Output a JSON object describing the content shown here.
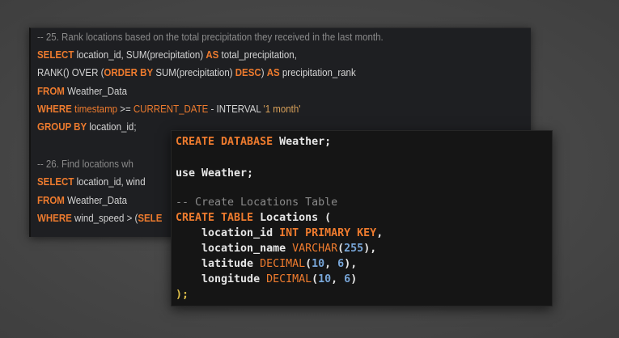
{
  "back_editor": {
    "q25_comment": "-- 25. Rank locations based on the total precipitation they received in the last month.",
    "q25_l1_kw": "SELECT",
    "q25_l1_rest": " location_id, SUM(precipitation) ",
    "q25_l1_as": "AS",
    "q25_l1_tail": " total_precipitation,",
    "q25_l2_a": "RANK() OVER (",
    "q25_l2_kw": "ORDER BY",
    "q25_l2_b": " SUM(precipitation) ",
    "q25_l2_desc": "DESC",
    "q25_l2_c": ") ",
    "q25_l2_as": "AS",
    "q25_l2_tail": " precipitation_rank",
    "q25_l3_kw": "FROM",
    "q25_l3_rest": " Weather_Data",
    "q25_l4_kw": "WHERE",
    "q25_l4_col": " timestamp",
    "q25_l4_op": " >= ",
    "q25_l4_cd": "CURRENT_DATE",
    "q25_l4_mid": " - INTERVAL ",
    "q25_l4_str": "'1 month'",
    "q25_l5_kw": "GROUP BY",
    "q25_l5_rest": " location_id;",
    "q26_comment": "-- 26. Find locations wh",
    "q26_l1_kw": "SELECT",
    "q26_l1_rest": " location_id, wind",
    "q26_l2_kw": "FROM",
    "q26_l2_rest": " Weather_Data",
    "q26_l3_kw": "WHERE",
    "q26_l3_rest": " wind_speed > (",
    "q26_l3_sel": "SELE"
  },
  "front_editor": {
    "l1_kw": "CREATE DATABASE",
    "l1_rest": " Weather;",
    "l2_text": "use Weather;",
    "l3_comment": "-- Create Locations Table",
    "l4_kw": "CREATE TABLE",
    "l4_rest": " Locations (",
    "l5_col": "    location_id ",
    "l5_kw": "INT PRIMARY KEY",
    "l5_tail": ",",
    "l6_col": "    location_name ",
    "l6_type": "VARCHAR",
    "l6_p1": "(",
    "l6_num": "255",
    "l6_p2": "),",
    "l7_col": "    latitude ",
    "l7_type": "DECIMAL",
    "l7_p1": "(",
    "l7_n1": "10",
    "l7_sep": ", ",
    "l7_n2": "6",
    "l7_p2": "),",
    "l8_col": "    longitude ",
    "l8_type": "DECIMAL",
    "l8_p1": "(",
    "l8_n1": "10",
    "l8_sep": ", ",
    "l8_n2": "6",
    "l8_p2": ")",
    "l9_text": ");"
  },
  "colors": {
    "keyword": "#ee7b2e",
    "number": "#78a6d8",
    "string": "#d9a15a",
    "comment": "#8a8a8a",
    "background": "#474747"
  }
}
